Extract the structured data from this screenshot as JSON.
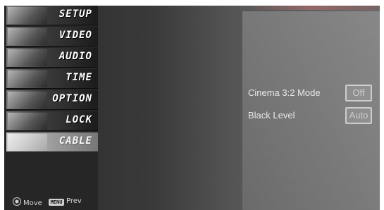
{
  "menu": {
    "items": [
      {
        "label": "SETUP",
        "icon": "setup-icon",
        "active": false
      },
      {
        "label": "VIDEO",
        "icon": "video-icon",
        "active": false
      },
      {
        "label": "AUDIO",
        "icon": "audio-icon",
        "active": false
      },
      {
        "label": "TIME",
        "icon": "time-icon",
        "active": false
      },
      {
        "label": "OPTION",
        "icon": "option-icon",
        "active": false
      },
      {
        "label": "LOCK",
        "icon": "lock-icon",
        "active": false
      },
      {
        "label": "CABLE",
        "icon": "cable-icon",
        "active": true
      }
    ]
  },
  "hints": {
    "move_label": "Move",
    "prev_icon_text": "MENU",
    "prev_label": "Prev"
  },
  "panel": {
    "rows": [
      {
        "label": "Cinema 3:2 Mode",
        "value": "Off"
      },
      {
        "label": "Black Level",
        "value": "Auto"
      }
    ]
  },
  "colors": {
    "accent_line": "#be6e6e",
    "panel_text": "#e9e9e9"
  }
}
